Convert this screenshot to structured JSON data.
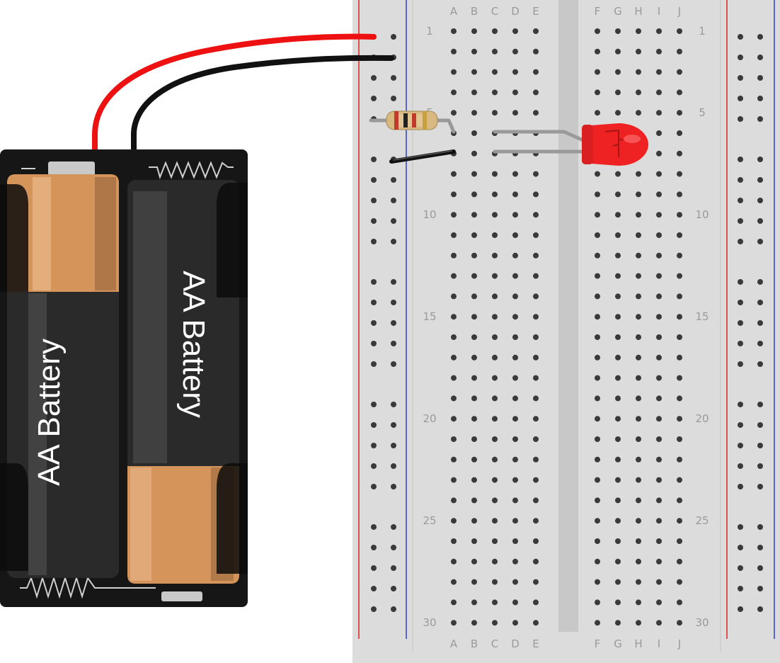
{
  "breadboard": {
    "column_labels_left": [
      "A",
      "B",
      "C",
      "D",
      "E"
    ],
    "column_labels_right": [
      "F",
      "G",
      "H",
      "I",
      "J"
    ],
    "row_numbers": [
      "1",
      "5",
      "10",
      "15",
      "20",
      "25",
      "30"
    ],
    "row_count": 30
  },
  "battery_pack": {
    "cell_left_label": "AA Battery",
    "cell_right_label": "AA Battery"
  },
  "components": {
    "resistor": "resistor",
    "led": "red LED",
    "jumper": "black jumper wire"
  },
  "colors": {
    "board": "#dcdcdc",
    "rail_positive": "#d62424",
    "rail_negative": "#2b3ccf",
    "wire_red": "#ee1111",
    "wire_black": "#111111",
    "led_red": "#ee2222",
    "battery_copper": "#d4945a",
    "battery_body": "#262626"
  }
}
